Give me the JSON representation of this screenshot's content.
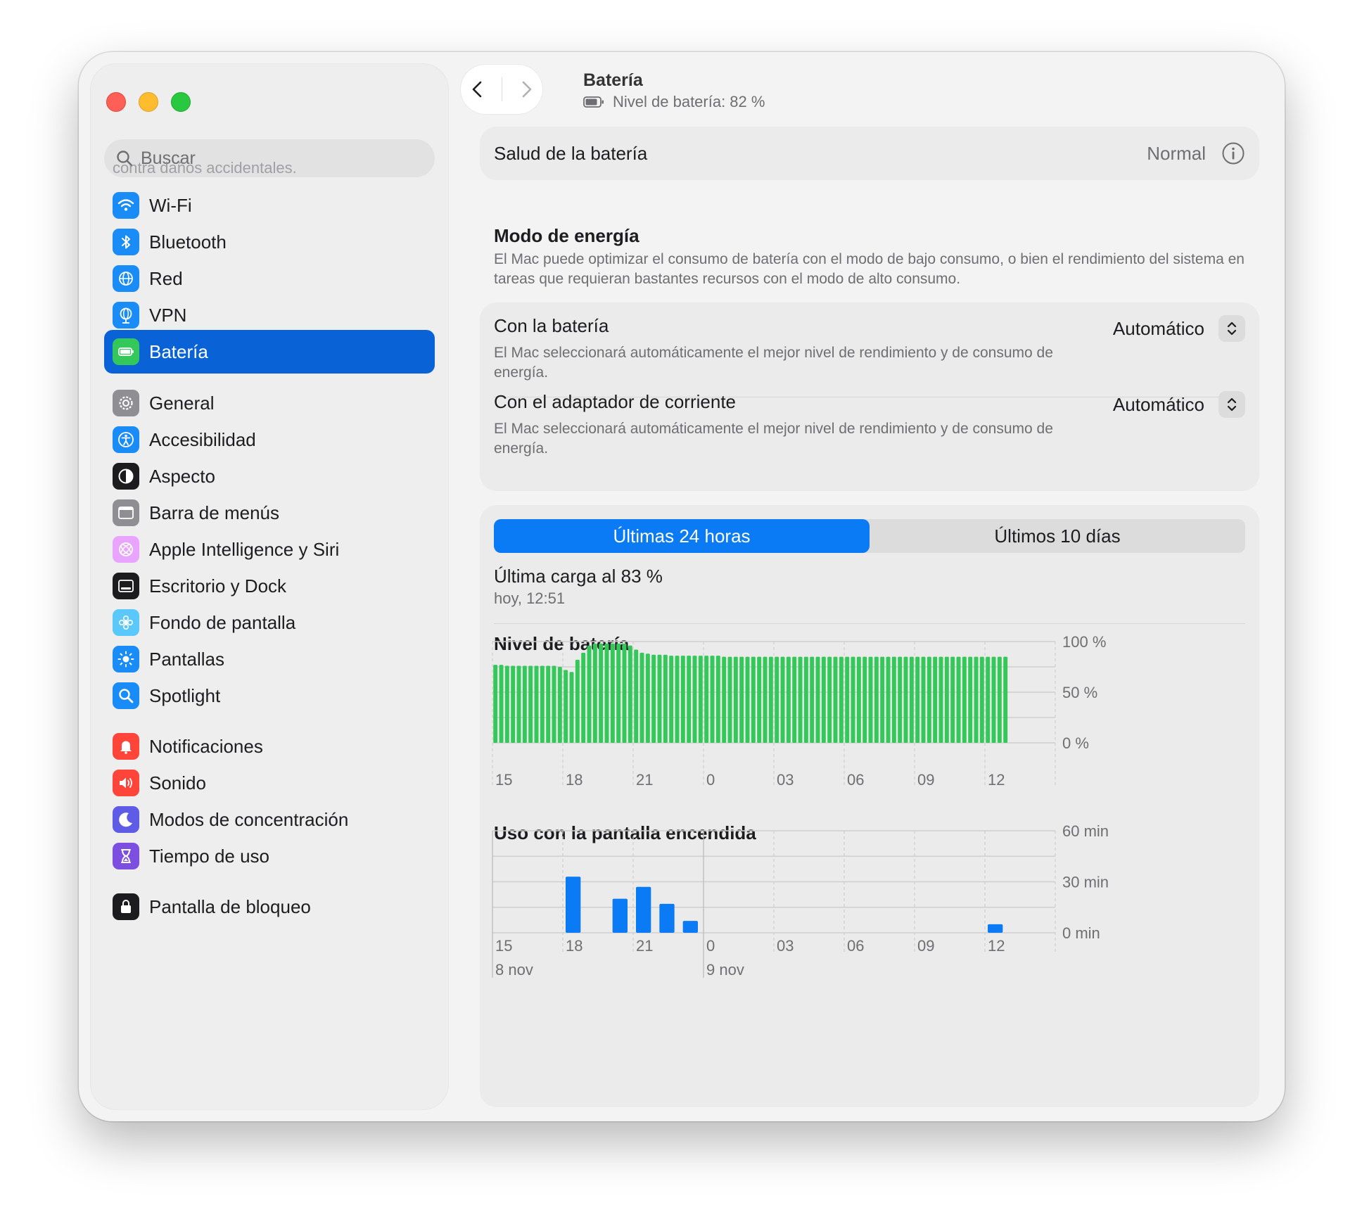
{
  "sidebar": {
    "search_placeholder": "Buscar",
    "search_ghost_text": "contra daños accidentales.",
    "items": [
      {
        "label": "Wi-Fi",
        "icon": "wifi-icon",
        "color": "#1a8cf8"
      },
      {
        "label": "Bluetooth",
        "icon": "bluetooth-icon",
        "color": "#1a8cf8"
      },
      {
        "label": "Red",
        "icon": "globe-icon",
        "color": "#1a8cf8"
      },
      {
        "label": "VPN",
        "icon": "vpn-globe-icon",
        "color": "#1a8cf8"
      },
      {
        "label": "Batería",
        "icon": "battery-icon",
        "color": "#34c759",
        "active": true
      },
      {
        "label": "General",
        "icon": "gear-icon",
        "color": "#8e8e93"
      },
      {
        "label": "Accesibilidad",
        "icon": "accessibility-icon",
        "color": "#1a8cf8"
      },
      {
        "label": "Aspecto",
        "icon": "appearance-icon",
        "color": "#1c1c1e"
      },
      {
        "label": "Barra de menús",
        "icon": "menubar-icon",
        "color": "#8e8e93"
      },
      {
        "label": "Apple Intelligence y Siri",
        "icon": "siri-icon",
        "color": "#e9a4ff"
      },
      {
        "label": "Escritorio y Dock",
        "icon": "dock-icon",
        "color": "#1c1c1e"
      },
      {
        "label": "Fondo de pantalla",
        "icon": "wallpaper-icon",
        "color": "#5ac8fa"
      },
      {
        "label": "Pantallas",
        "icon": "brightness-icon",
        "color": "#1a8cf8"
      },
      {
        "label": "Spotlight",
        "icon": "spotlight-icon",
        "color": "#1a8cf8"
      },
      {
        "label": "Notificaciones",
        "icon": "bell-icon",
        "color": "#ff453a"
      },
      {
        "label": "Sonido",
        "icon": "speaker-icon",
        "color": "#ff453a"
      },
      {
        "label": "Modos de concentración",
        "icon": "moon-icon",
        "color": "#5e5ce6"
      },
      {
        "label": "Tiempo de uso",
        "icon": "hourglass-icon",
        "color": "#7d4fe0"
      },
      {
        "label": "Pantalla de bloqueo",
        "icon": "lock-icon",
        "color": "#1c1c1e"
      }
    ]
  },
  "header": {
    "title": "Batería",
    "subtitle": "Nivel de batería: 82 %"
  },
  "health": {
    "label": "Salud de la batería",
    "value": "Normal"
  },
  "energy_mode": {
    "title": "Modo de energía",
    "description": "El Mac puede optimizar el consumo de batería con el modo de bajo consumo, o bien el rendimiento del sistema en tareas que requieran bastantes recursos con el modo de alto consumo.",
    "rows": [
      {
        "title": "Con la batería",
        "description": "El Mac seleccionará automáticamente el mejor nivel de rendimiento y de consumo de energía.",
        "value": "Automático"
      },
      {
        "title": "Con el adaptador de corriente",
        "description": "El Mac seleccionará automáticamente el mejor nivel de rendimiento y de consumo de energía.",
        "value": "Automático"
      }
    ]
  },
  "usage": {
    "tabs": [
      {
        "label": "Últimas 24 horas",
        "active": true
      },
      {
        "label": "Últimos 10 días",
        "active": false
      }
    ],
    "last_charge_title": "Última carga al 83 %",
    "last_charge_time": "hoy, 12:51",
    "battery_chart_title": "Nivel de batería",
    "screen_chart_title": "Uso con la pantalla encendida"
  },
  "chart_data": [
    {
      "type": "bar",
      "title": "Nivel de batería",
      "x_tick_labels": [
        "15",
        "18",
        "21",
        "0",
        "03",
        "06",
        "09",
        "12"
      ],
      "y_tick_labels": [
        "100 %",
        "50 %",
        "0 %"
      ],
      "ylim": [
        0,
        100
      ],
      "color": "#34c759",
      "grid": true,
      "values": [
        77,
        77,
        76,
        76,
        76,
        76,
        76,
        76,
        76,
        76,
        76,
        75,
        72,
        70,
        82,
        89,
        96,
        98,
        98,
        98,
        98,
        98,
        98,
        96,
        92,
        89,
        88,
        87,
        87,
        87,
        86,
        86,
        86,
        86,
        86,
        86,
        86,
        86,
        86,
        85,
        85,
        85,
        85,
        85,
        85,
        85,
        85,
        85,
        85,
        85,
        85,
        85,
        85,
        85,
        85,
        85,
        85,
        85,
        85,
        85,
        85,
        85,
        85,
        85,
        85,
        85,
        85,
        85,
        85,
        85,
        85,
        85,
        85,
        85,
        85,
        85,
        85,
        85,
        85,
        85,
        85,
        85,
        85,
        85,
        85,
        85,
        85,
        85
      ]
    },
    {
      "type": "bar",
      "title": "Uso con la pantalla encendida",
      "x_tick_labels": [
        "15",
        "18",
        "21",
        "0",
        "03",
        "06",
        "09",
        "12"
      ],
      "x_date_labels": [
        "8 nov",
        "9 nov"
      ],
      "y_tick_labels": [
        "60 min",
        "30 min",
        "0 min"
      ],
      "ylim": [
        0,
        60
      ],
      "color": "#0a7af5",
      "grid": true,
      "hour_slots": [
        "18",
        "20",
        "21",
        "22",
        "23",
        "12"
      ],
      "values": [
        33,
        20,
        27,
        17,
        7,
        5
      ]
    }
  ]
}
